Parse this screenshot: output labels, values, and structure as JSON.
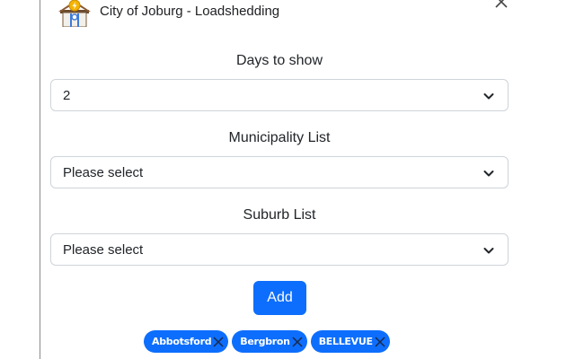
{
  "app": {
    "title": "City of Joburg - Loadshedding",
    "icon": "house-power-icon"
  },
  "colors": {
    "accent": "#0d6efd",
    "text": "#212529",
    "border": "#ced4da"
  },
  "form": {
    "days": {
      "label": "Days to show",
      "value": "2"
    },
    "municipality": {
      "label": "Municipality List",
      "value": "Please select"
    },
    "suburb": {
      "label": "Suburb List",
      "value": "Please select"
    },
    "add_label": "Add"
  },
  "chips": [
    {
      "label": "Abbotsford"
    },
    {
      "label": "Bergbron"
    },
    {
      "label": "BELLEVUE"
    }
  ]
}
